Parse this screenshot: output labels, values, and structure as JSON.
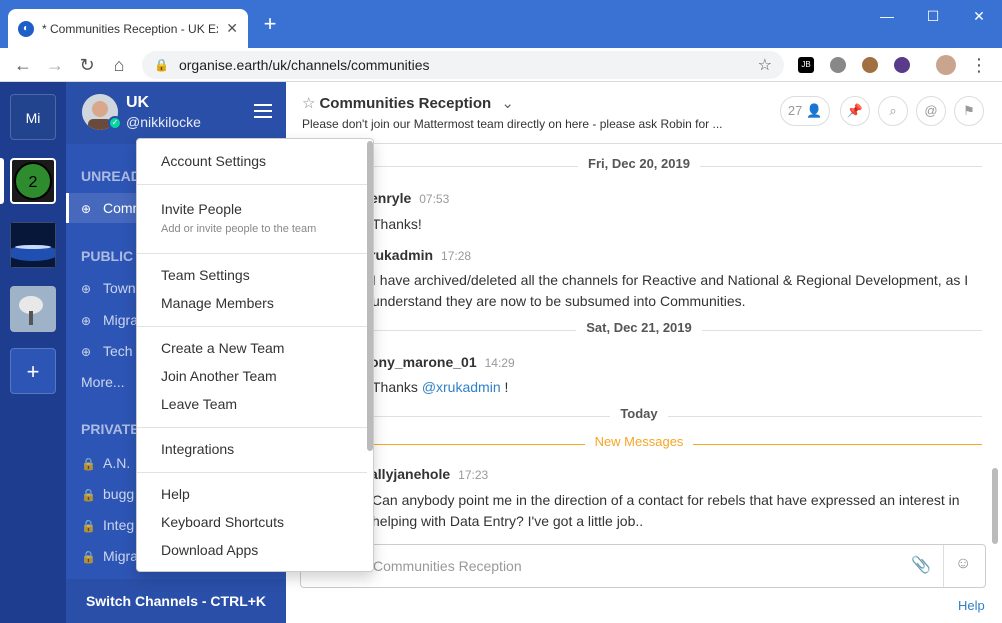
{
  "browser": {
    "tab_title": "* Communities Reception - UK Ex",
    "url": "organise.earth/uk/channels/communities",
    "win_min": "—",
    "win_max": "☐",
    "win_close": "✕",
    "ext_jb": "JB"
  },
  "teams": [
    {
      "label": "Mi"
    },
    {
      "label": ""
    },
    {
      "label": ""
    },
    {
      "label": ""
    },
    {
      "label": "+"
    }
  ],
  "sidebar": {
    "team_name": "UK",
    "username": "@nikkilocke",
    "unread_header": "UNREAD",
    "unread_item": "Comm",
    "public_header": "PUBLIC C",
    "public_items": [
      "Town",
      "Migra",
      "Tech"
    ],
    "more": "More...",
    "private_header": "PRIVATE",
    "private_items": [
      "A.N.",
      "bugg",
      "Integ",
      "Migra"
    ],
    "footer": "Switch Channels - CTRL+K"
  },
  "header": {
    "title": "Communities Reception",
    "purpose": "Please don't join our Mattermost team directly on here - please ask Robin for ...",
    "member_count": "27"
  },
  "posts": {
    "date1": "Fri, Dec 20, 2019",
    "p1_user": "enryle",
    "p1_time": "07:53",
    "p1_text": "Thanks!",
    "p2_user": "rukadmin",
    "p2_time": "17:28",
    "p2_text": "I have archived/deleted all the channels for Reactive and National & Regional Development, as I understand they are now to be subsumed into Communities.",
    "date2": "Sat, Dec 21, 2019",
    "p3_user": "ony_marone_01",
    "p3_time": "14:29",
    "p3_text_pre": "Thanks ",
    "p3_mention": "@xrukadmin",
    "p3_text_post": " !",
    "today": "Today",
    "new_messages": "New Messages",
    "p4_user": "allyjanehole",
    "p4_time": "17:23",
    "p4_text": "Can anybody point me in the direction of a contact for rebels that have expressed an interest in helping with Data Entry? I've got a little job.."
  },
  "composer": {
    "placeholder": "Communities Reception"
  },
  "help": "Help",
  "menu": {
    "account_settings": "Account Settings",
    "invite_people": "Invite People",
    "invite_sub": "Add or invite people to the team",
    "team_settings": "Team Settings",
    "manage_members": "Manage Members",
    "create_team": "Create a New Team",
    "join_team": "Join Another Team",
    "leave_team": "Leave Team",
    "integrations": "Integrations",
    "help": "Help",
    "shortcuts": "Keyboard Shortcuts",
    "download_apps": "Download Apps"
  },
  "colors": {
    "titlebar": "#3a72d4",
    "team_sidebar": "#1e3d8f",
    "channel_sidebar": "#2d55b5",
    "new_messages": "#f5a623",
    "link": "#2f81c7"
  }
}
